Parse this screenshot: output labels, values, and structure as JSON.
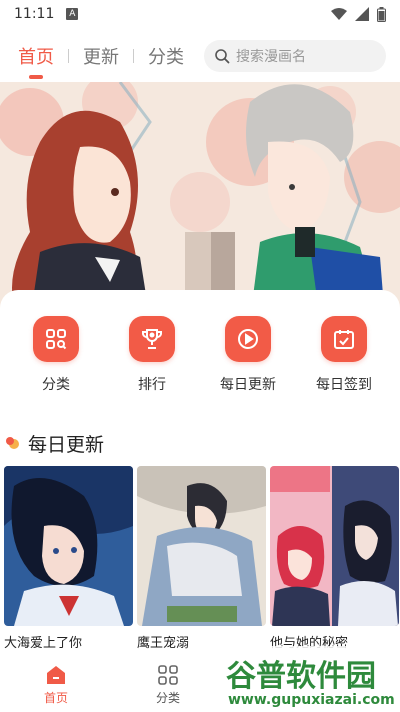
{
  "status_bar": {
    "time": "11:11",
    "notification_badge": "A"
  },
  "top_nav": {
    "tabs": [
      {
        "label": "首页",
        "active": true
      },
      {
        "label": "更新",
        "active": false
      },
      {
        "label": "分类",
        "active": false
      }
    ],
    "search": {
      "placeholder": "搜索漫画名"
    }
  },
  "banner": {
    "image": "comic-illustration-couple"
  },
  "quick_menu": [
    {
      "label": "分类",
      "icon": "grid-search-icon"
    },
    {
      "label": "排行",
      "icon": "trophy-icon"
    },
    {
      "label": "每日更新",
      "icon": "play-circle-icon"
    },
    {
      "label": "每日签到",
      "icon": "calendar-check-icon"
    }
  ],
  "section": {
    "title": "每日更新"
  },
  "comics": [
    {
      "title": "大海爱上了你"
    },
    {
      "title": "鹰王宠溺"
    },
    {
      "title": "他与她的秘密"
    }
  ],
  "bottom_nav": [
    {
      "label": "首页",
      "icon": "home-icon",
      "active": true
    },
    {
      "label": "分类",
      "icon": "grid-icon",
      "active": false
    }
  ],
  "watermark": {
    "text": "谷普软件园",
    "url": "www.gupuxiazai.com"
  },
  "colors": {
    "accent": "#f05a47"
  }
}
